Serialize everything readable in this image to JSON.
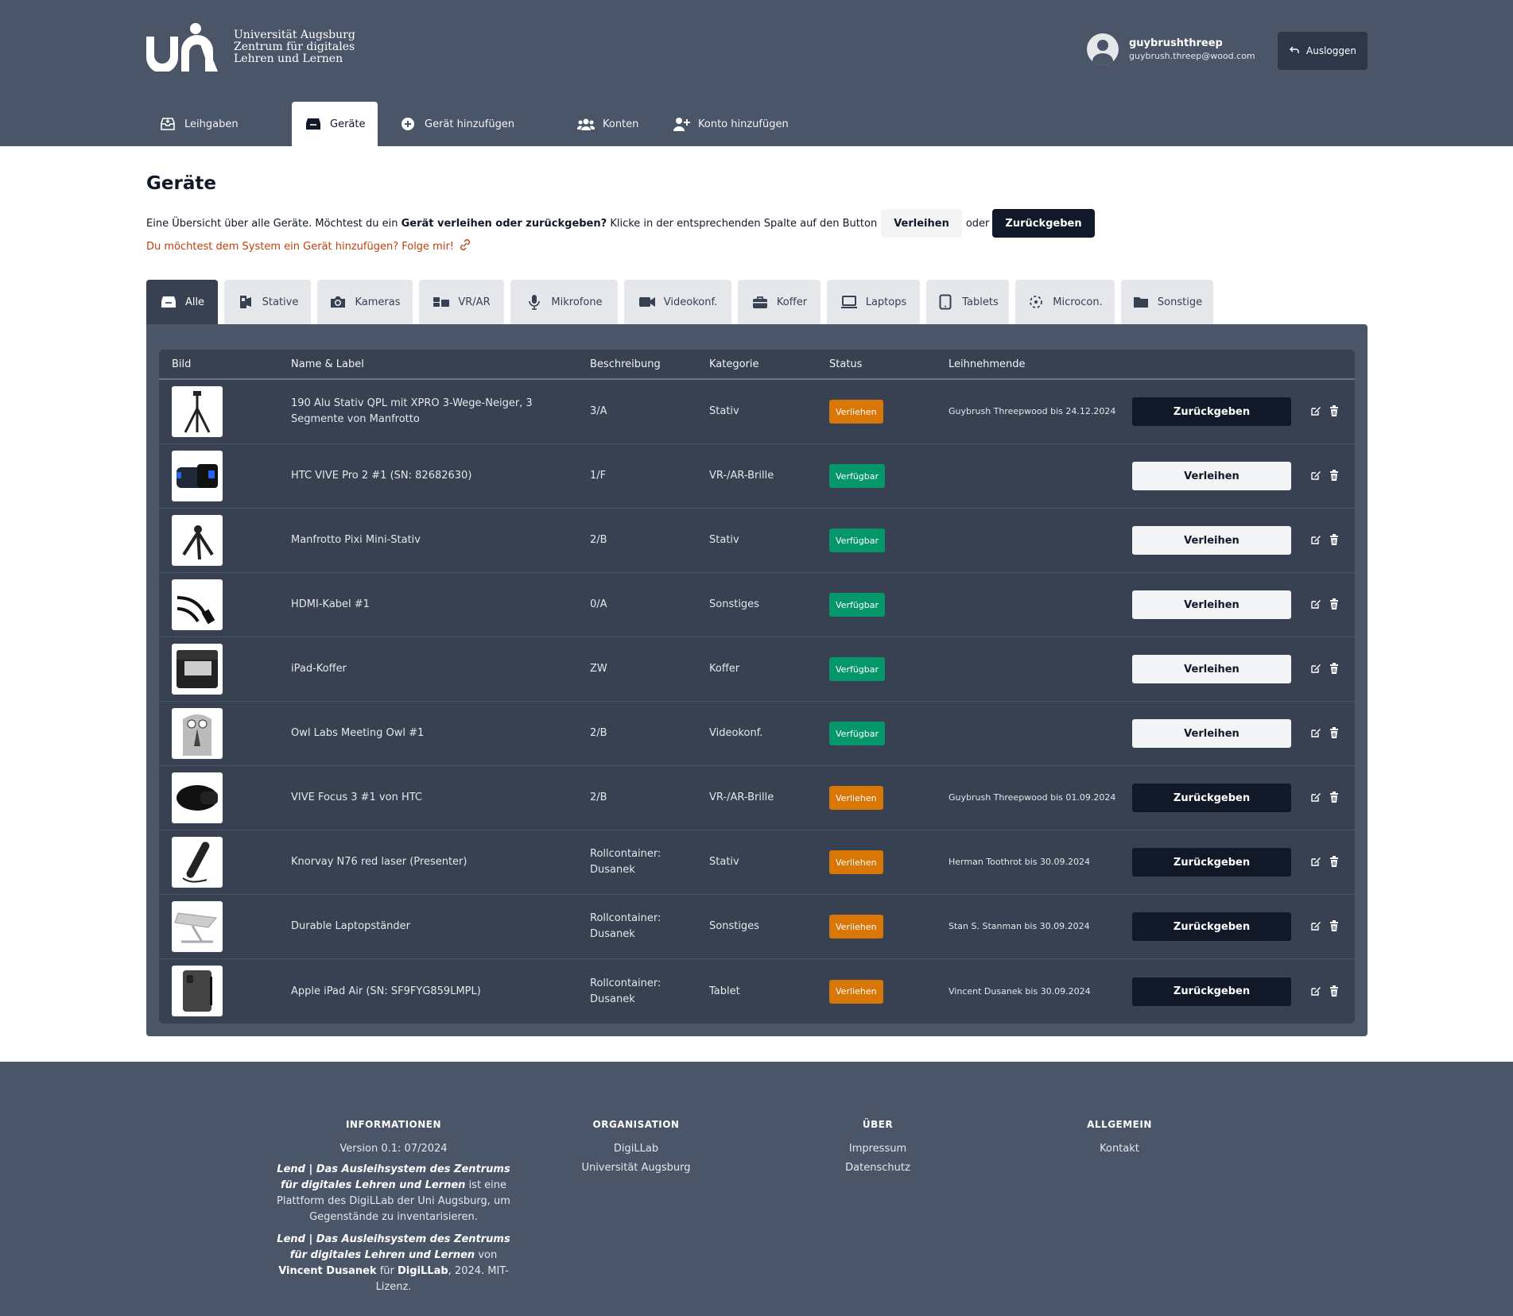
{
  "header": {
    "logo_text_lines": [
      "Universität Augsburg",
      "Zentrum für digitales",
      "Lehren und Lernen"
    ],
    "user": {
      "name": "guybrushthreep",
      "email": "guybrush.threep@wood.com"
    },
    "logout_label": "Ausloggen"
  },
  "nav": {
    "items": [
      {
        "label": "Leihgaben",
        "icon": "inbox-icon"
      },
      {
        "label": "Geräte",
        "icon": "drawer-icon"
      },
      {
        "label": "Gerät hinzufügen",
        "icon": "plus-circle-icon"
      },
      {
        "label": "Konten",
        "icon": "users-icon"
      },
      {
        "label": "Konto hinzufügen",
        "icon": "user-plus-icon"
      }
    ]
  },
  "main": {
    "title": "Geräte",
    "intro_part1": "Eine Übersicht über alle Geräte. Möchtest du ein",
    "intro_bold": "Gerät verleihen oder zurückgeben?",
    "intro_part2": "Klicke in der entsprechenden Spalte auf den Button",
    "intro_btn_lend": "Verleihen",
    "intro_or": "oder",
    "intro_btn_return": "Zurückgeben",
    "add_link": "Du möchtest dem System ein Gerät hinzufügen? Folge mir!"
  },
  "categories": [
    {
      "label": "Alle",
      "icon": "drawer-icon"
    },
    {
      "label": "Stative",
      "icon": "tripod-icon"
    },
    {
      "label": "Kameras",
      "icon": "camera-icon"
    },
    {
      "label": "VR/AR",
      "icon": "vr-icon"
    },
    {
      "label": "Mikrofone",
      "icon": "microphone-icon"
    },
    {
      "label": "Videokonf.",
      "icon": "video-icon"
    },
    {
      "label": "Koffer",
      "icon": "briefcase-icon"
    },
    {
      "label": "Laptops",
      "icon": "laptop-icon"
    },
    {
      "label": "Tablets",
      "icon": "tablet-icon"
    },
    {
      "label": "Microcon.",
      "icon": "chip-icon"
    },
    {
      "label": "Sonstige",
      "icon": "folder-icon"
    }
  ],
  "table": {
    "headers": [
      "Bild",
      "Name & Label",
      "Beschreibung",
      "Kategorie",
      "Status",
      "Leihnehmende"
    ],
    "rows": [
      {
        "name": "190 Alu Stativ QPL mit XPRO 3-Wege-Neiger, 3 Segmente von Manfrotto",
        "desc": "3/A",
        "category": "Stativ",
        "status": "Verliehen",
        "borrower": "Guybrush Threepwood bis 24.12.2024",
        "action": "Zurückgeben",
        "image": "tripod"
      },
      {
        "name": "HTC VIVE Pro 2 #1 (SN: 82682630)",
        "desc": "1/F",
        "category": "VR-/AR-Brille",
        "status": "Verfügbar",
        "borrower": "",
        "action": "Verleihen",
        "image": "vr-headset"
      },
      {
        "name": "Manfrotto Pixi Mini-Stativ",
        "desc": "2/B",
        "category": "Stativ",
        "status": "Verfügbar",
        "borrower": "",
        "action": "Verleihen",
        "image": "mini-tripod"
      },
      {
        "name": "HDMI-Kabel #1",
        "desc": "0/A",
        "category": "Sonstiges",
        "status": "Verfügbar",
        "borrower": "",
        "action": "Verleihen",
        "image": "cable"
      },
      {
        "name": "iPad-Koffer",
        "desc": "ZW",
        "category": "Koffer",
        "status": "Verfügbar",
        "borrower": "",
        "action": "Verleihen",
        "image": "case"
      },
      {
        "name": "Owl Labs Meeting Owl #1",
        "desc": "2/B",
        "category": "Videokonf.",
        "status": "Verfügbar",
        "borrower": "",
        "action": "Verleihen",
        "image": "owl"
      },
      {
        "name": "VIVE Focus 3 #1 von HTC",
        "desc": "2/B",
        "category": "VR-/AR-Brille",
        "status": "Verliehen",
        "borrower": "Guybrush Threepwood bis 01.09.2024",
        "action": "Zurückgeben",
        "image": "vr-focus"
      },
      {
        "name": "Knorvay N76 red laser (Presenter)",
        "desc": "Rollcontainer: Dusanek",
        "category": "Stativ",
        "status": "Verliehen",
        "borrower": "Herman Toothrot bis 30.09.2024",
        "action": "Zurückgeben",
        "image": "presenter"
      },
      {
        "name": "Durable Laptopständer",
        "desc": "Rollcontainer: Dusanek",
        "category": "Sonstiges",
        "status": "Verliehen",
        "borrower": "Stan S. Stanman bis 30.09.2024",
        "action": "Zurückgeben",
        "image": "laptop-stand"
      },
      {
        "name": "Apple iPad Air (SN: SF9FYG859LMPL)",
        "desc": "Rollcontainer: Dusanek",
        "category": "Tablet",
        "status": "Verliehen",
        "borrower": "Vincent Dusanek bis 30.09.2024",
        "action": "Zurückgeben",
        "image": "ipad"
      }
    ]
  },
  "footer": {
    "info": {
      "heading": "INFORMATIONEN",
      "version": "Version 0.1: 07/2024",
      "p1_em": "Lend | Das Ausleihsystem des Zentrums für digitales Lehren und Lernen",
      "p1_rest": "ist eine Plattform des DigiLLab der Uni Augsburg, um Gegenstände zu inventarisieren.",
      "p2_em": "Lend | Das Ausleihsystem des Zentrums für digitales Lehren und Lernen",
      "p2_von": "von",
      "p2_author": "Vincent Dusanek",
      "p2_fuer": "für",
      "p2_org": "DigiLLab",
      "p2_rest": ", 2024. MIT-Lizenz."
    },
    "org": {
      "heading": "ORGANISATION",
      "links": [
        "DigiLLab",
        "Universität Augsburg"
      ]
    },
    "about": {
      "heading": "ÜBER",
      "links": [
        "Impressum",
        "Datenschutz"
      ]
    },
    "general": {
      "heading": "ALLGEMEIN",
      "links": [
        "Kontakt"
      ]
    }
  },
  "colors": {
    "header_bg": "#4a5568",
    "table_bg": "#374151",
    "status_lent": "#d97706",
    "status_free": "#059669",
    "link_orange": "#c2410c"
  }
}
